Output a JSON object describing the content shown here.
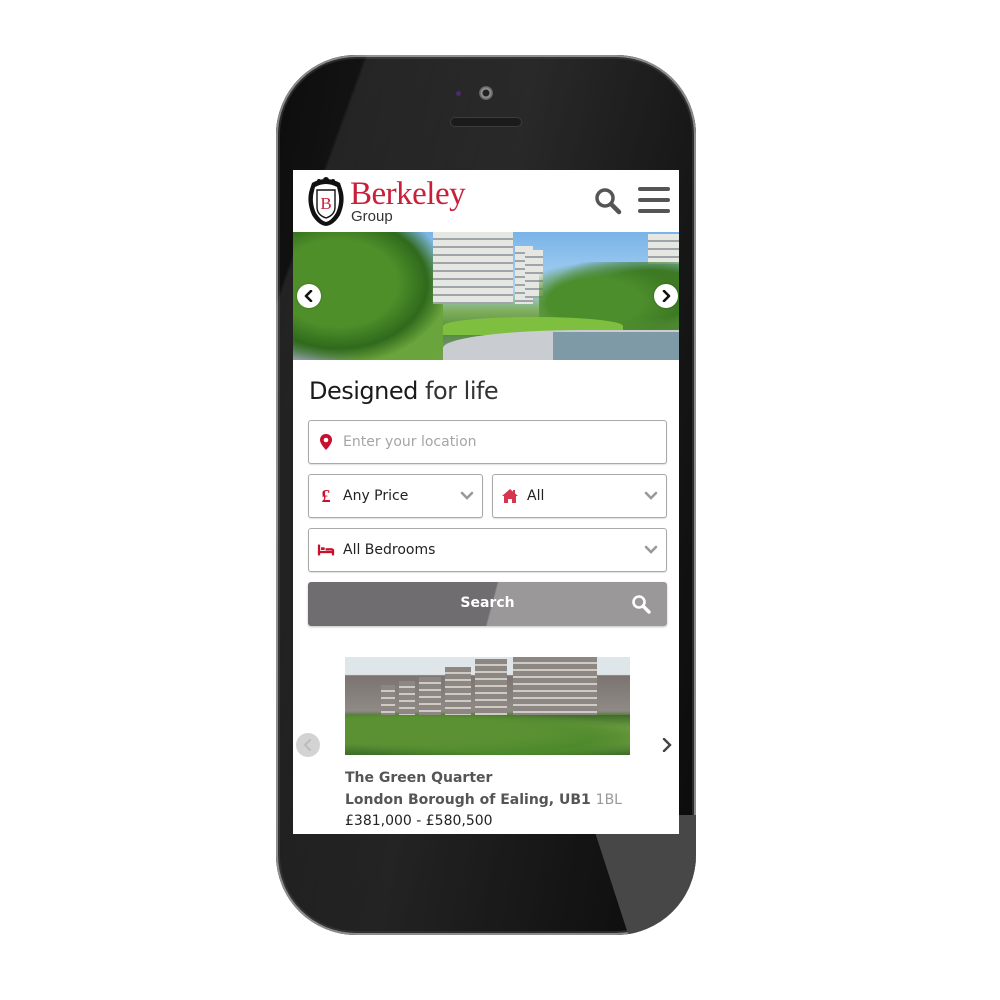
{
  "header": {
    "brand_name": "Berkeley",
    "brand_sub": "Group",
    "crest_letter": "B",
    "search_icon": "search-icon",
    "menu_icon": "hamburger-menu-icon"
  },
  "hero": {
    "prev_icon": "chevron-left-icon",
    "next_icon": "chevron-right-icon",
    "image_alt": "Residential towers with landscaped plaza and fountains"
  },
  "tagline": {
    "bold": "Designed",
    "light": "for life"
  },
  "search_form": {
    "location": {
      "placeholder": "Enter your location",
      "value": "",
      "icon": "map-pin-icon"
    },
    "price": {
      "selected": "Any Price",
      "icon": "pound-icon"
    },
    "property_type": {
      "selected": "All",
      "icon": "home-icon"
    },
    "bedrooms": {
      "selected": "All Bedrooms",
      "icon": "bed-icon"
    },
    "search_label": "Search",
    "search_icon": "search-icon"
  },
  "featured": {
    "name": "The Green Quarter",
    "location_main": "London Borough of Ealing, UB1",
    "location_postcode": "1BL",
    "price_range": "£381,000 - £580,500",
    "prev_icon": "chevron-left-icon",
    "next_icon": "chevron-right-icon"
  },
  "colors": {
    "brand_red": "#c8203a",
    "button_grey": "#6f6d70",
    "text_grey": "#555555"
  }
}
